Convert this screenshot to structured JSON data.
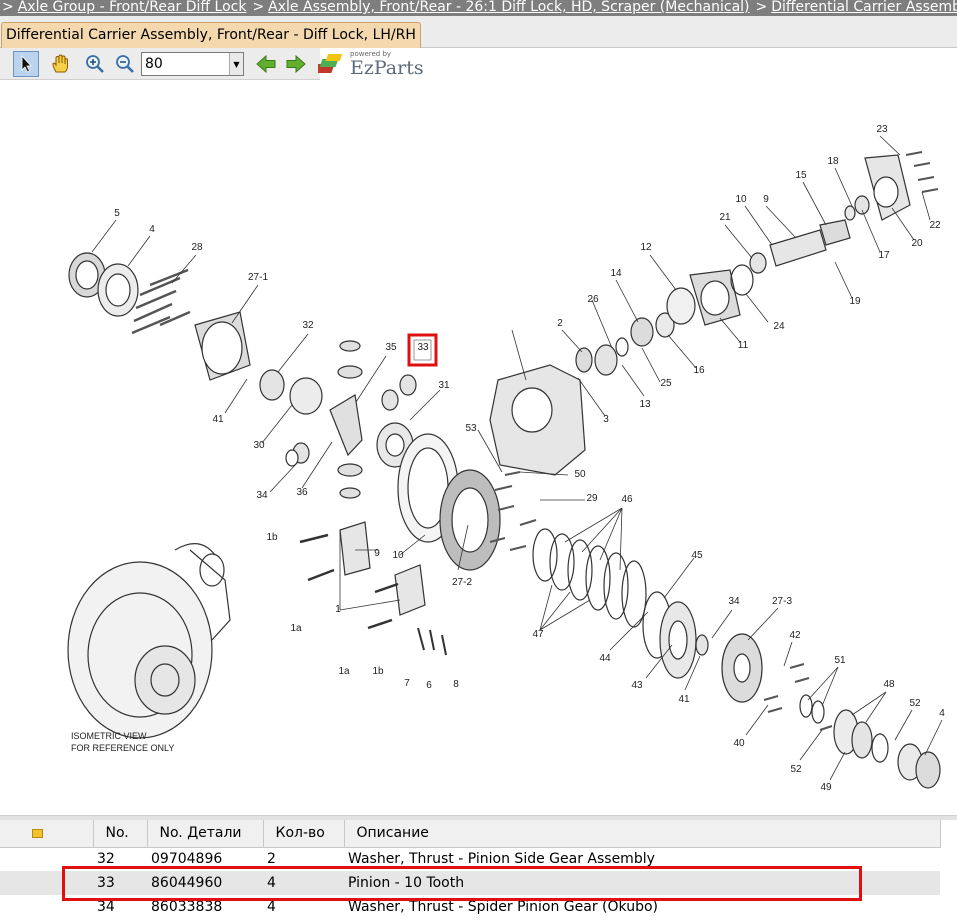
{
  "breadcrumb": {
    "items": [
      "Axle Group - Front/Rear Diff Lock",
      "Axle Assembly, Front/Rear - 26:1 Diff Lock, HD, Scraper (Mechanical)",
      "Differential Carrier Assembly, Front/Rear - Diff Lock, LH/RH"
    ],
    "separator": ">"
  },
  "tab": {
    "label": "Differential Carrier Assembly, Front/Rear - Diff Lock, LH/RH"
  },
  "toolbar": {
    "zoom_value": "80",
    "logo_powered": "powered by",
    "logo_brand": "EzParts",
    "icons": [
      "pointer-icon",
      "pan-hand-icon",
      "zoom-in-icon",
      "zoom-out-icon",
      "back-arrow-icon",
      "forward-arrow-icon",
      "ezparts-logo-icon"
    ]
  },
  "diagram": {
    "callouts": [
      "1",
      "1a",
      "1a",
      "1b",
      "1b",
      "2",
      "3",
      "4",
      "4",
      "5",
      "6",
      "7",
      "8",
      "9",
      "9",
      "10",
      "10",
      "11",
      "12",
      "13",
      "14",
      "15",
      "16",
      "17",
      "18",
      "19",
      "20",
      "21",
      "22",
      "23",
      "24",
      "25",
      "26",
      "27-1",
      "27-2",
      "27-3",
      "28",
      "29",
      "30",
      "31",
      "32",
      "33",
      "34",
      "34",
      "35",
      "36",
      "40",
      "41",
      "41",
      "42",
      "43",
      "44",
      "45",
      "46",
      "47",
      "48",
      "49",
      "50",
      "51",
      "52",
      "52",
      "53"
    ],
    "highlighted_callout": "33",
    "iso_note_line1": "ISOMETRIC VIEW",
    "iso_note_line2": "FOR REFERENCE ONLY"
  },
  "table": {
    "headers": [
      "No.",
      "No. Детали",
      "Кол-во",
      "Описание"
    ],
    "rows": [
      {
        "no": "32",
        "part": "09704896",
        "qty": "2",
        "desc": "Washer, Thrust - Pinion Side Gear Assembly"
      },
      {
        "no": "33",
        "part": "86044960",
        "qty": "4",
        "desc": "Pinion - 10 Tooth"
      },
      {
        "no": "34",
        "part": "86033838",
        "qty": "4",
        "desc": "Washer, Thrust - Spider Pinion Gear (Okubo)"
      }
    ],
    "selected_row": "33"
  },
  "colors": {
    "highlight": "#e01010",
    "tab_bg": "#f4d9ae",
    "breadcrumb_bg": "#7e7e7e",
    "arrow_green": "#5fae2e"
  }
}
